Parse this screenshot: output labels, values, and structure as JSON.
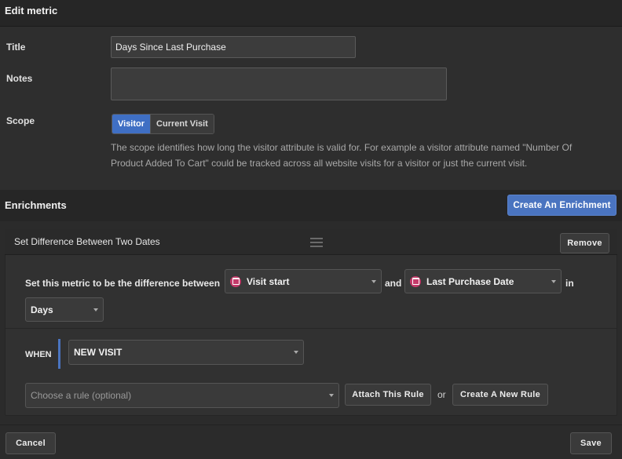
{
  "header": {
    "title": "Edit metric"
  },
  "form": {
    "title_label": "Title",
    "title_value": "Days Since Last Purchase",
    "notes_label": "Notes",
    "notes_value": "",
    "scope_label": "Scope",
    "scope_options": [
      "Visitor",
      "Current Visit"
    ],
    "scope_selected": "Visitor",
    "scope_help": "The scope identifies how long the visitor attribute is valid for. For example a visitor attribute named \"Number Of Product Added To Cart\" could be tracked across all website visits for a visitor or just the current visit."
  },
  "enrichments": {
    "title": "Enrichments",
    "create_button": "Create An Enrichment",
    "card": {
      "title": "Set Difference Between Two Dates",
      "remove_button": "Remove",
      "sentence_prefix": "Set this metric to be the difference between",
      "first_date": "Visit start",
      "and_text": "and",
      "second_date": "Last Purchase Date",
      "in_text": "in",
      "unit": "Days",
      "when_label": "WHEN",
      "when_value": "NEW VISIT",
      "rule_placeholder": "Choose a rule (optional)",
      "attach_button": "Attach This Rule",
      "or_text": "or",
      "new_rule_button": "Create A New Rule"
    }
  },
  "footer": {
    "cancel_button": "Cancel",
    "save_button": "Save"
  },
  "colors": {
    "accent": "#4a74c0",
    "calendar_icon": "#c43a6a"
  },
  "icons": {
    "date_picker": "calendar-icon",
    "drag": "drag-handle-icon",
    "dropdown": "caret-down-icon"
  }
}
